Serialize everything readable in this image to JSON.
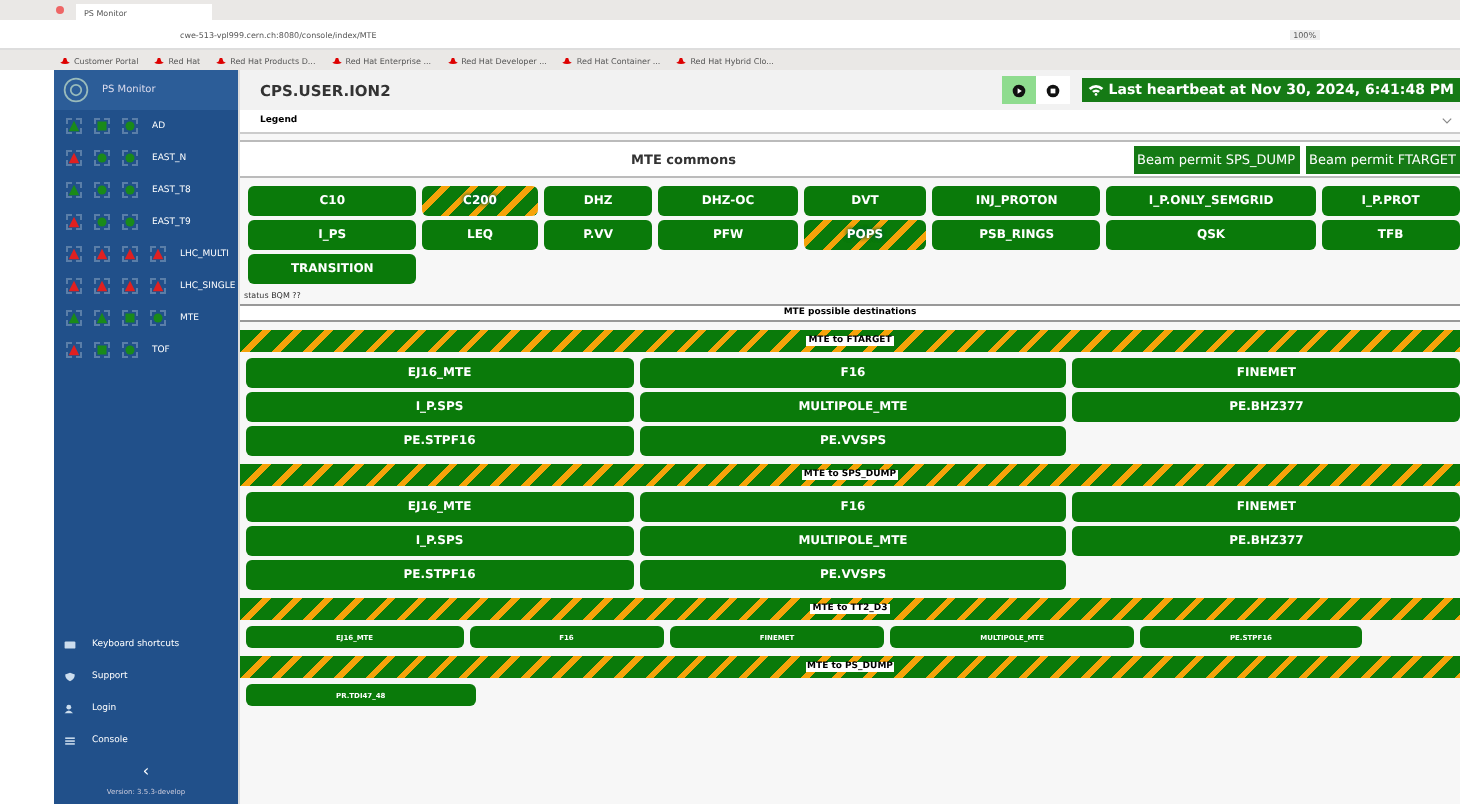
{
  "browser": {
    "tab_title": "PS Monitor",
    "url": "cwe-513-vpl999.cern.ch:8080/console/index/MTE",
    "zoom": "100%",
    "bookmarks": [
      "Customer Portal",
      "Red Hat",
      "Red Hat Products D...",
      "Red Hat Enterprise ...",
      "Red Hat Developer ...",
      "Red Hat Container ...",
      "Red Hat Hybrid Clo..."
    ]
  },
  "sidebar": {
    "title": "PS Monitor",
    "items": [
      {
        "label": "AD",
        "indicators": [
          {
            "kind": "triangle",
            "color": "#1a8a1a"
          },
          {
            "kind": "square",
            "color": "#1a8a1a"
          },
          {
            "kind": "circle",
            "color": "#1a8a1a"
          }
        ]
      },
      {
        "label": "EAST_N",
        "indicators": [
          {
            "kind": "triangle",
            "color": "#e02020"
          },
          {
            "kind": "circle",
            "color": "#1a8a1a"
          },
          {
            "kind": "circle",
            "color": "#1a8a1a"
          }
        ]
      },
      {
        "label": "EAST_T8",
        "indicators": [
          {
            "kind": "triangle",
            "color": "#1a8a1a"
          },
          {
            "kind": "circle",
            "color": "#1a8a1a"
          },
          {
            "kind": "circle",
            "color": "#1a8a1a"
          }
        ]
      },
      {
        "label": "EAST_T9",
        "indicators": [
          {
            "kind": "triangle",
            "color": "#e02020"
          },
          {
            "kind": "circle",
            "color": "#1a8a1a"
          },
          {
            "kind": "circle",
            "color": "#1a8a1a"
          }
        ]
      },
      {
        "label": "LHC_MULTI",
        "indicators": [
          {
            "kind": "triangle",
            "color": "#e02020"
          },
          {
            "kind": "triangle",
            "color": "#e02020"
          },
          {
            "kind": "triangle",
            "color": "#e02020"
          },
          {
            "kind": "triangle",
            "color": "#e02020"
          }
        ]
      },
      {
        "label": "LHC_SINGLE",
        "indicators": [
          {
            "kind": "triangle",
            "color": "#e02020"
          },
          {
            "kind": "triangle",
            "color": "#e02020"
          },
          {
            "kind": "triangle",
            "color": "#e02020"
          },
          {
            "kind": "triangle",
            "color": "#e02020"
          }
        ]
      },
      {
        "label": "MTE",
        "indicators": [
          {
            "kind": "triangle",
            "color": "#1a8a1a"
          },
          {
            "kind": "triangle",
            "color": "#1a8a1a"
          },
          {
            "kind": "square",
            "color": "#1a8a1a"
          },
          {
            "kind": "circle",
            "color": "#1a8a1a"
          }
        ]
      },
      {
        "label": "TOF",
        "indicators": [
          {
            "kind": "triangle",
            "color": "#e02020"
          },
          {
            "kind": "square",
            "color": "#1a8a1a"
          },
          {
            "kind": "circle",
            "color": "#1a8a1a"
          }
        ]
      }
    ],
    "footer": [
      {
        "kind": "keyboard",
        "label": "Keyboard shortcuts"
      },
      {
        "kind": "support",
        "label": "Support"
      },
      {
        "kind": "login",
        "label": "Login"
      },
      {
        "kind": "console",
        "label": "Console"
      }
    ],
    "collapse": "‹",
    "version": "Version: 3.5.3-develop"
  },
  "header": {
    "title": "CPS.USER.ION2",
    "controls": [
      {
        "kind": "play",
        "selected": true
      },
      {
        "kind": "stop",
        "selected": false
      }
    ],
    "heartbeat": "Last heartbeat at Nov 30, 2024, 6:41:48 PM"
  },
  "legend": {
    "label": "Legend"
  },
  "commons": {
    "title": "MTE commons",
    "permits": [
      "Beam permit SPS_DUMP",
      "Beam permit FTARGET"
    ],
    "elements": [
      {
        "label": "C10",
        "striped": false
      },
      {
        "label": "C200",
        "striped": true
      },
      {
        "label": "DHZ",
        "striped": false
      },
      {
        "label": "DHZ-OC",
        "striped": false
      },
      {
        "label": "DVT",
        "striped": false
      },
      {
        "label": "INJ_PROTON",
        "striped": false
      },
      {
        "label": "I_P.ONLY_SEMGRID",
        "striped": false
      },
      {
        "label": "I_P.PROT",
        "striped": false
      },
      {
        "label": "I_PS",
        "striped": false
      },
      {
        "label": "LEQ",
        "striped": false
      },
      {
        "label": "P.VV",
        "striped": false
      },
      {
        "label": "PFW",
        "striped": false
      },
      {
        "label": "POPS",
        "striped": true
      },
      {
        "label": "PSB_RINGS",
        "striped": false
      },
      {
        "label": "QSK",
        "striped": false
      },
      {
        "label": "TFB",
        "striped": false
      },
      {
        "label": "TRANSITION",
        "striped": false
      }
    ],
    "status_note": "status BQM ??"
  },
  "destinations": {
    "title": "MTE possible destinations",
    "groups": [
      {
        "title": "MTE to FTARGET",
        "kind": "large",
        "elements": [
          "EJ16_MTE",
          "F16",
          "FINEMET",
          "I_P.SPS",
          "MULTIPOLE_MTE",
          "PE.BHZ377",
          "PE.STPF16",
          "PE.VVSPS"
        ]
      },
      {
        "title": "MTE to SPS_DUMP",
        "kind": "large",
        "elements": [
          "EJ16_MTE",
          "F16",
          "FINEMET",
          "I_P.SPS",
          "MULTIPOLE_MTE",
          "PE.BHZ377",
          "PE.STPF16",
          "PE.VVSPS"
        ]
      },
      {
        "title": "MTE to TT2_D3",
        "kind": "small",
        "elements": [
          "EJ16_MTE",
          "F16",
          "FINEMET",
          "MULTIPOLE_MTE",
          "PE.STPF16"
        ]
      },
      {
        "title": "MTE to PS_DUMP",
        "kind": "small",
        "elements": [
          "PR.TDI47_48"
        ]
      }
    ]
  }
}
